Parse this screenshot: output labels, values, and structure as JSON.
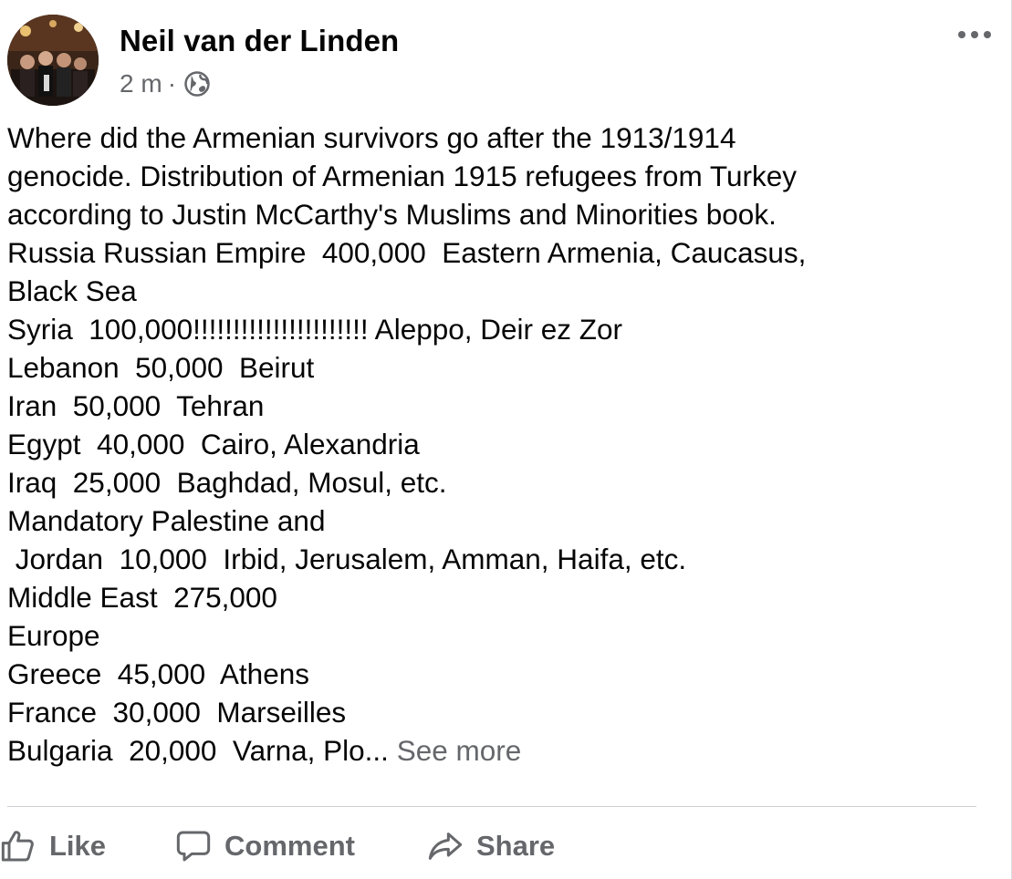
{
  "post": {
    "author": "Neil van der Linden",
    "time": "2 m",
    "separator": "·",
    "audience_icon": "globe-icon",
    "menu_icon": "more-horizontal-icon",
    "body_lines": [
      "Where did the Armenian survivors go after the 1913/1914",
      "genocide. Distribution of Armenian 1915 refugees from Turkey",
      "according to Justin McCarthy's Muslims and Minorities book.",
      "Russia Russian Empire  400,000  Eastern Armenia, Caucasus,",
      "Black Sea",
      "Syria  100,000!!!!!!!!!!!!!!!!!!!!!! Aleppo, Deir ez Zor",
      "Lebanon  50,000  Beirut",
      "Iran  50,000  Tehran",
      "Egypt  40,000  Cairo, Alexandria",
      "Iraq  25,000  Baghdad, Mosul, etc.",
      "Mandatory Palestine and",
      " Jordan  10,000  Irbid, Jerusalem, Amman, Haifa, etc.",
      "Middle East  275,000",
      "Europe",
      "Greece  45,000  Athens",
      "France  30,000  Marseilles"
    ],
    "last_line": "Bulgaria  20,000  Varna, Plo...",
    "see_more": "See more"
  },
  "actions": {
    "like": "Like",
    "comment": "Comment",
    "share": "Share"
  },
  "colors": {
    "text": "#050505",
    "secondary": "#65676b",
    "divider": "#ced0d4"
  }
}
